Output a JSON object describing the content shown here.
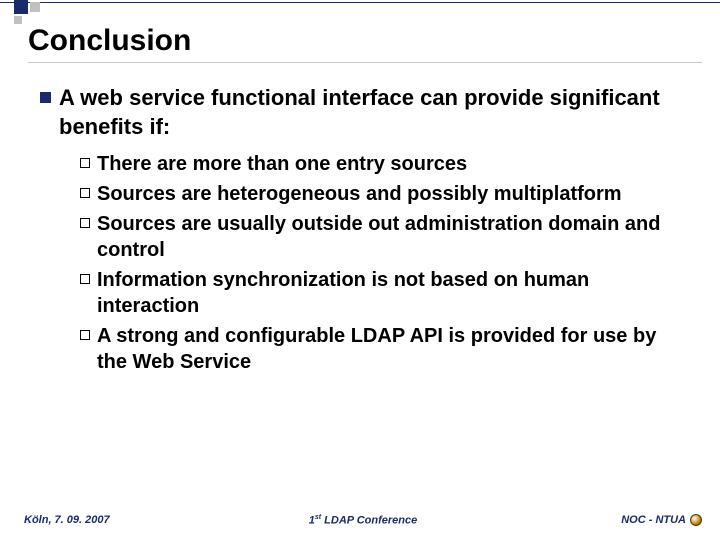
{
  "title": "Conclusion",
  "main_point": "A web service functional interface can provide significant benefits if:",
  "sub_points": [
    "There are more than one entry sources",
    "Sources are heterogeneous and possibly multiplatform",
    "Sources are usually outside out administration domain and control",
    "Information synchronization is not based on human interaction",
    "A strong and configurable LDAP API is provided for use by the Web Service"
  ],
  "footer": {
    "left": "Köln, 7. 09. 2007",
    "center_pre": "1",
    "center_sup": "st",
    "center_post": " LDAP Conference",
    "right": "NOC - NTUA"
  }
}
